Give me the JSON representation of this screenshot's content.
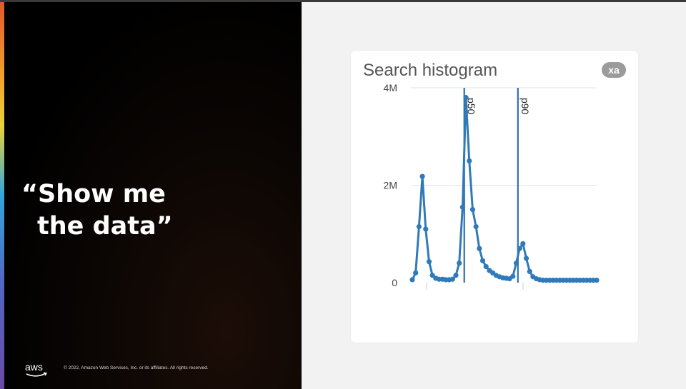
{
  "slide": {
    "quote_line1": "“Show me",
    "quote_line2": "the data”",
    "copyright": "© 2022, Amazon Web Services, Inc. or its affiliates. All rights reserved.",
    "logo_text": "aws",
    "colors": {
      "background": "#000000",
      "quote": "#ffffff",
      "right_panel": "#f2f2f2"
    }
  },
  "card": {
    "title": "Search histogram",
    "badge": "xa",
    "badge_icon": "close-icon"
  },
  "chart_data": {
    "type": "line",
    "title": "Search histogram",
    "ylim": [
      0,
      4000000
    ],
    "yticks": [
      {
        "value": 0,
        "label": "0"
      },
      {
        "value": 2000000,
        "label": "2M"
      },
      {
        "value": 4000000,
        "label": "4M"
      }
    ],
    "grid": true,
    "markers": [
      {
        "label": "p50",
        "x": 15.5
      },
      {
        "label": "p90",
        "x": 31.5
      }
    ],
    "x": [
      0,
      1,
      2,
      3,
      4,
      5,
      6,
      7,
      8,
      9,
      10,
      11,
      12,
      13,
      14,
      15,
      16,
      17,
      18,
      19,
      20,
      21,
      22,
      23,
      24,
      25,
      26,
      27,
      28,
      29,
      30,
      31,
      32,
      33,
      34,
      35,
      36,
      37,
      38,
      39,
      40,
      41,
      42,
      43,
      44,
      45,
      46,
      47,
      48,
      49,
      50,
      51,
      52,
      53,
      54,
      55
    ],
    "series": [
      {
        "color": "#2f7ab8",
        "values": [
          60000,
          200000,
          1150000,
          2180000,
          1100000,
          430000,
          150000,
          90000,
          70000,
          70000,
          60000,
          60000,
          70000,
          150000,
          400000,
          1550000,
          3800000,
          2500000,
          1500000,
          1150000,
          700000,
          450000,
          330000,
          250000,
          200000,
          150000,
          120000,
          100000,
          90000,
          80000,
          130000,
          400000,
          700000,
          800000,
          500000,
          230000,
          120000,
          80000,
          60000,
          50000,
          50000,
          50000,
          50000,
          50000,
          50000,
          50000,
          50000,
          50000,
          50000,
          50000,
          50000,
          50000,
          50000,
          50000,
          50000,
          50000
        ]
      }
    ]
  }
}
